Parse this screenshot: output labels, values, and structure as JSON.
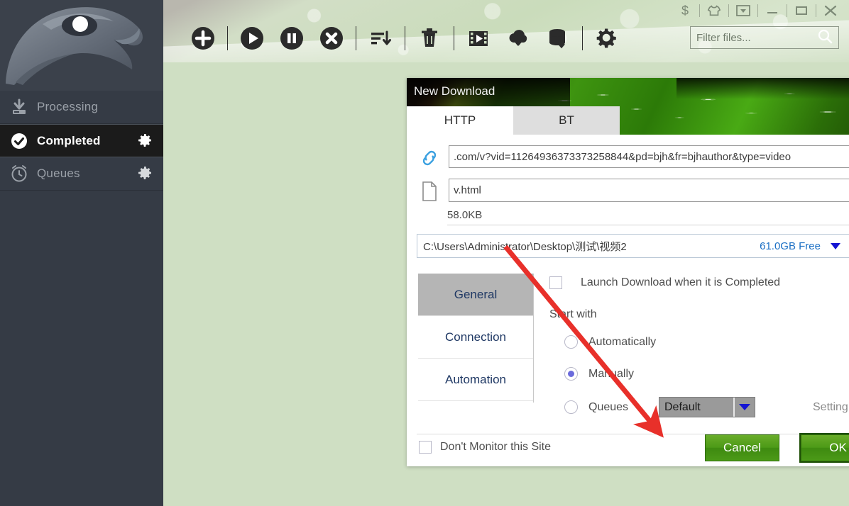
{
  "window": {
    "title_controls": [
      {
        "name": "donate-icon",
        "glyph": "$"
      },
      {
        "name": "skin-icon",
        "glyph": "shirt"
      },
      {
        "name": "tray-icon",
        "glyph": "tray"
      },
      {
        "name": "minimize-icon",
        "glyph": "minimize"
      },
      {
        "name": "maximize-icon",
        "glyph": "maximize"
      },
      {
        "name": "close-icon",
        "glyph": "close"
      }
    ]
  },
  "sidebar": {
    "logo_name": "eagle-logo",
    "items": [
      {
        "label": "Processing",
        "icon": "download-tray-icon",
        "selected": false,
        "gear": false
      },
      {
        "label": "Completed",
        "icon": "check-circle-icon",
        "selected": true,
        "gear": true
      },
      {
        "label": "Queues",
        "icon": "alarm-clock-icon",
        "selected": false,
        "gear": true
      }
    ]
  },
  "toolbar": {
    "buttons": [
      {
        "name": "add-download-button",
        "icon": "plus-circle-icon"
      },
      {
        "name": "start-button",
        "icon": "play-circle-icon"
      },
      {
        "name": "pause-button",
        "icon": "pause-circle-icon"
      },
      {
        "name": "cancel-button",
        "icon": "cancel-circle-icon"
      },
      {
        "name": "sort-button",
        "icon": "sort-descending-icon"
      },
      {
        "name": "delete-button",
        "icon": "trash-icon"
      },
      {
        "name": "video-converter-button",
        "icon": "film-strip-icon"
      },
      {
        "name": "download-cloud-button",
        "icon": "cloud-download-icon"
      },
      {
        "name": "disk-download-button",
        "icon": "database-download-icon"
      },
      {
        "name": "settings-button",
        "icon": "gear-icon"
      }
    ]
  },
  "search": {
    "placeholder": "Filter files...",
    "value": "",
    "icon": "search-icon"
  },
  "dialog": {
    "title": "New Download",
    "close_icon": "close-icon",
    "tabs": [
      {
        "label": "HTTP",
        "active": true
      },
      {
        "label": "BT",
        "active": false
      }
    ],
    "url_field": {
      "icon": "link-icon",
      "value": ".com/v?vid=11264936373373258844&pd=bjh&fr=bjhauthor&type=video"
    },
    "filename_field": {
      "icon": "file-icon",
      "value": "v.html"
    },
    "size": {
      "value": "58.0KB",
      "dropdown_icon": "chevron-down-icon"
    },
    "path": {
      "value": "C:\\Users\\Administrator\\Desktop\\测试\\视频2",
      "free_space": "61.0GB Free",
      "dropdown_icon": "chevron-down-icon",
      "browse_icon": "folder-icon"
    },
    "subtabs": [
      {
        "label": "General",
        "active": true
      },
      {
        "label": "Connection",
        "active": false
      },
      {
        "label": "Automation",
        "active": false
      }
    ],
    "launch_option": {
      "label": "Launch Download when it is Completed",
      "checked": false
    },
    "start_with": {
      "label": "Start with",
      "options": [
        {
          "label": "Automatically",
          "selected": false
        },
        {
          "label": "Manually",
          "selected": true
        },
        {
          "label": "Queues",
          "selected": false
        }
      ]
    },
    "queue_select": {
      "value": "Default",
      "arrow_icon": "triangle-down-icon"
    },
    "setting_link": "Setting...",
    "dont_monitor": {
      "label": "Don't Monitor this Site",
      "checked": false
    },
    "cancel_label": "Cancel",
    "ok_label": "OK"
  },
  "colors": {
    "accent_green": "#4d9a17",
    "radio_blue": "#6a6adc",
    "link_blue": "#1b6fc4",
    "annotation_red": "#e8302a",
    "sidebar_bg": "#353b45",
    "app_bg": "#cfdfc3"
  }
}
